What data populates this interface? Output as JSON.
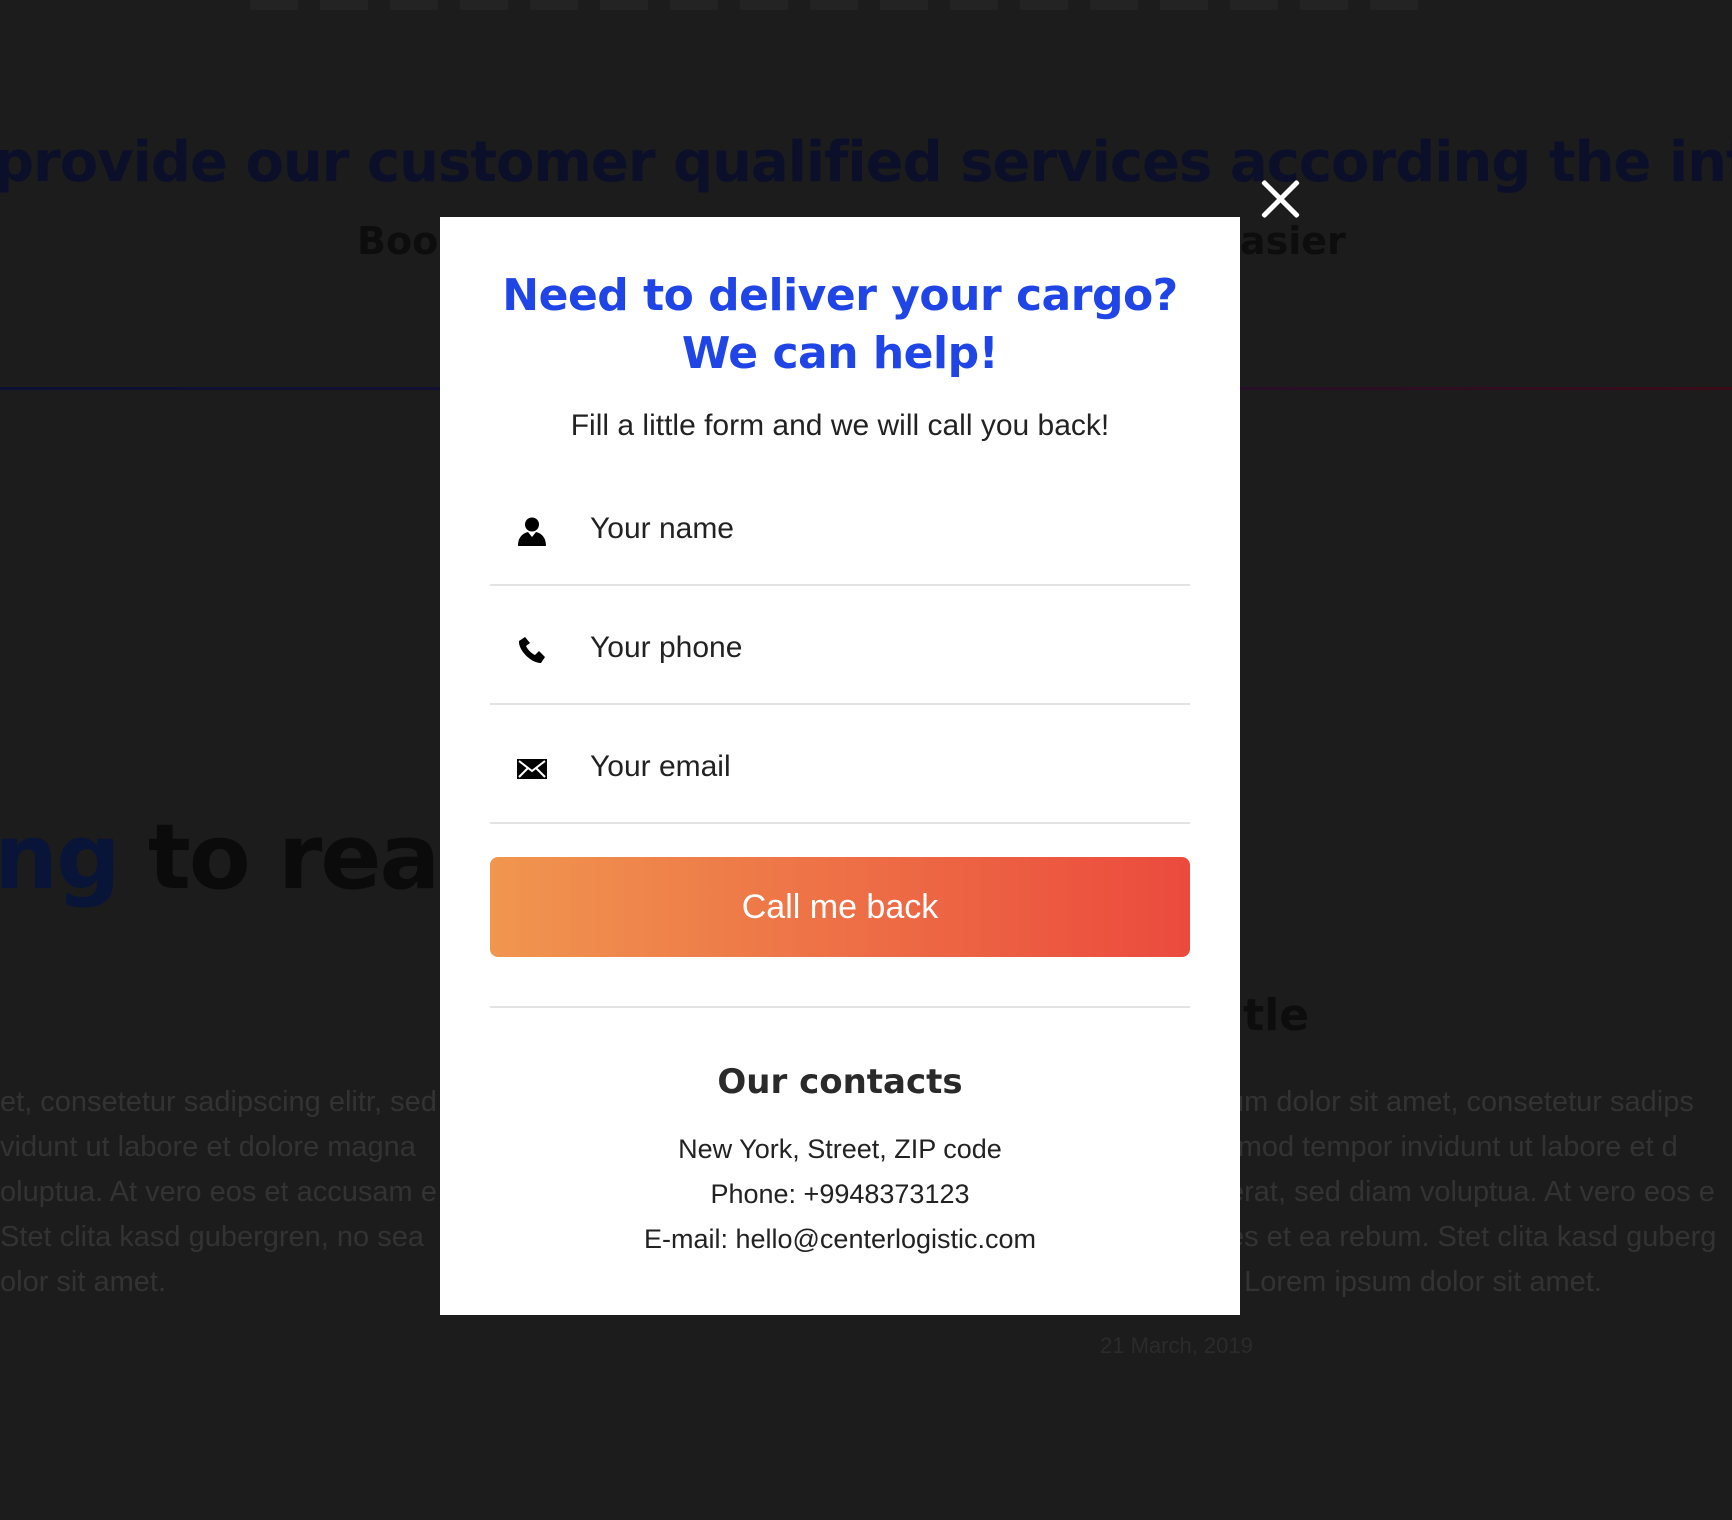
{
  "background": {
    "headline": "provide our customer qualified services according the internationa",
    "subheadline_left": "Boo",
    "subheadline_right": "asier",
    "section_title_accent": "ng",
    "section_title_rest": " to read",
    "card_title": "itle",
    "para_left": [
      "et, consetetur sadipscing elitr, sed",
      "vidunt ut labore et dolore magna",
      "oluptua. At vero eos et accusam e",
      "Stet clita kasd gubergren, no sea",
      "olor sit amet."
    ],
    "para_right": [
      "um dolor sit amet, consetetur sadips",
      "rmod tempor invidunt ut labore et d",
      "erat, sed diam voluptua. At vero eos e",
      "es et ea rebum. Stet clita kasd guberg",
      "t Lorem ipsum dolor sit amet."
    ],
    "date": "21 March, 2019"
  },
  "modal": {
    "title": "Need to deliver your cargo? We can help!",
    "subtitle": "Fill a little form and we will call you back!",
    "fields": {
      "name": {
        "placeholder": "Your name",
        "icon": "user-icon"
      },
      "phone": {
        "placeholder": "Your phone",
        "icon": "phone-icon"
      },
      "email": {
        "placeholder": "Your email",
        "icon": "envelope-icon"
      }
    },
    "submit_label": "Call me back",
    "contacts": {
      "title": "Our contacts",
      "address": "New York, Street, ZIP code",
      "phone": "Phone: +9948373123",
      "email": "E-mail: hello@centerlogistic.com"
    }
  },
  "colors": {
    "overlay": "#1c1c1c",
    "title_blue": "#1f45e6",
    "button_gradient_start": "#f0964f",
    "button_gradient_end": "#eb4a3d"
  }
}
